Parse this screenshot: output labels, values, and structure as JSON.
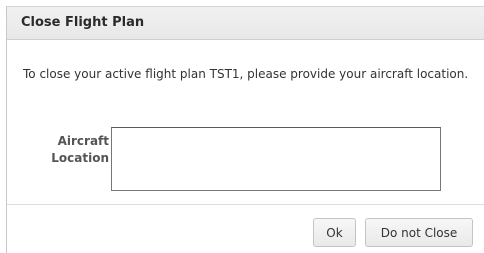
{
  "dialog": {
    "title": "Close Flight Plan",
    "message": "To close your active flight plan TST1, please provide your aircraft location.",
    "field": {
      "label_line1": "Aircraft",
      "label_line2": "Location",
      "value": ""
    },
    "buttons": {
      "ok_label": "Ok",
      "do_not_close_label": "Do not Close"
    }
  }
}
